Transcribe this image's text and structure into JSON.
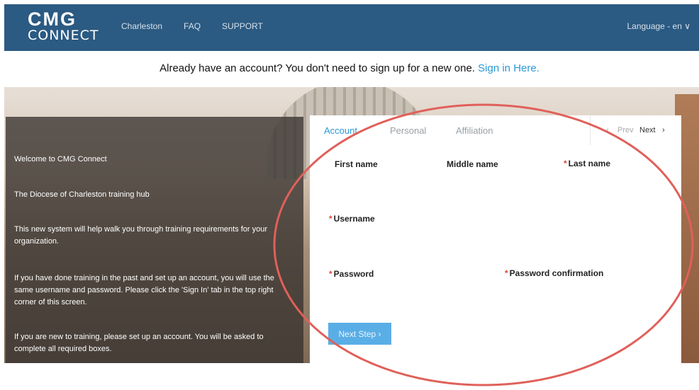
{
  "header": {
    "logo_top": "CMG",
    "logo_bottom": "CONNECT",
    "nav": [
      "Charleston",
      "FAQ",
      "SUPPORT"
    ],
    "language": "Language - en ∨"
  },
  "banner": {
    "text": "Already have an account? You don't need to sign up for a new one.",
    "link": "Sign in Here."
  },
  "welcome": {
    "title": "Welcome to CMG Connect",
    "subtitle": "The Diocese of Charleston training hub",
    "p1": "This new system will help walk you through training requirements for your organization.",
    "p2": "If you have done training in the past and set up an account, you will use the same username and password. Please click the 'Sign In' tab in the top right corner of this screen.",
    "p3": "If you are new to training, please set up an account. You will be asked to complete all required boxes."
  },
  "form": {
    "tabs": [
      "Account",
      "Personal",
      "Affiliation"
    ],
    "pager": {
      "prev": "Prev",
      "next": "Next"
    },
    "fields": {
      "first_name": "First name",
      "middle_name": "Middle name",
      "last_name": "Last name",
      "username": "Username",
      "password": "Password",
      "password_confirmation": "Password confirmation"
    },
    "next_step": "Next Step ›"
  },
  "colors": {
    "header_bg": "#2b5a82",
    "accent": "#2a9ad6",
    "required": "#e0453a",
    "annotation": "#e0605a"
  }
}
